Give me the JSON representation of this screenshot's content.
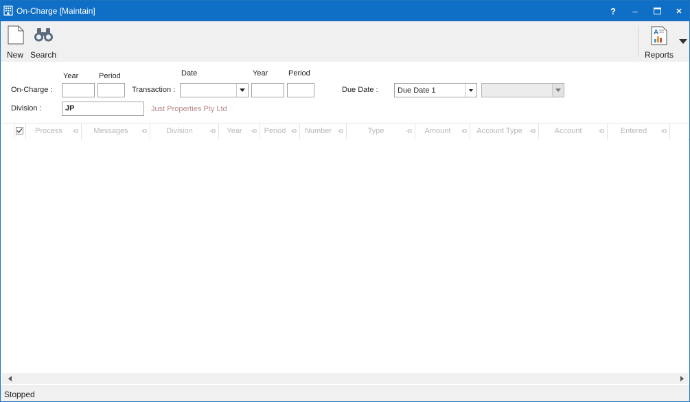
{
  "window": {
    "title": "On-Charge [Maintain]",
    "help_glyph": "?",
    "minimize_glyph": "–",
    "close_glyph": "✕",
    "title_bar_color": "#0f6fc6"
  },
  "toolbar": {
    "new_label": "New",
    "search_label": "Search",
    "reports_label": "Reports",
    "icons": {
      "new": "document-icon",
      "search": "binoculars-icon",
      "reports": "report-icon",
      "more": "dropdown-arrow-icon"
    }
  },
  "form": {
    "year_header": "Year",
    "period_header": "Period",
    "date_header": "Date",
    "txn_year_header": "Year",
    "txn_period_header": "Period",
    "on_charge_label": "On-Charge :",
    "on_charge_year": "",
    "on_charge_period": "",
    "transaction_label": "Transaction :",
    "transaction_date": "",
    "transaction_year": "",
    "transaction_period": "",
    "due_date_label": "Due Date :",
    "due_date_selected": "Due Date 1",
    "due_date_secondary": "",
    "division_label": "Division :",
    "division_value": "JP",
    "division_name": "Just Properties Pty Ltd"
  },
  "grid": {
    "columns": [
      "Process",
      "Messages",
      "Division",
      "Year",
      "Period",
      "Number",
      "Type",
      "Amount",
      "Account Type",
      "Account",
      "Entered"
    ],
    "rows": []
  },
  "status": {
    "text": "Stopped"
  }
}
